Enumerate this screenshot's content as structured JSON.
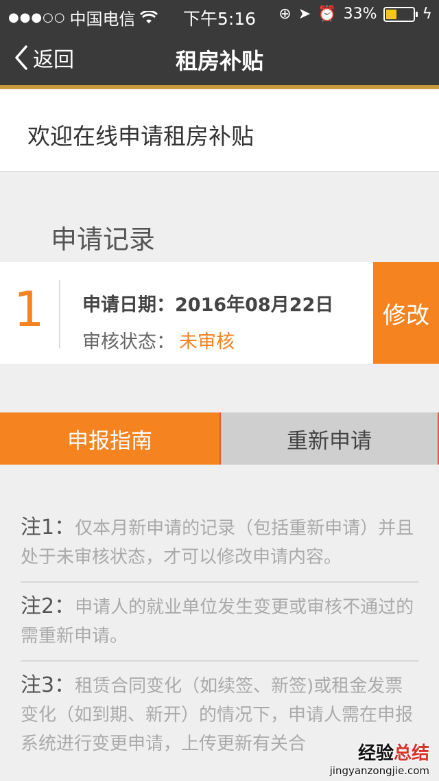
{
  "status": {
    "carrier": "中国电信",
    "time": "下午5:16",
    "battery": "33%"
  },
  "nav": {
    "back_label": "返回",
    "title": "租房补贴"
  },
  "welcome": "欢迎在线申请租房补贴",
  "section_title": "申请记录",
  "record": {
    "index": "1",
    "date_label": "申请日期：",
    "date_value": "2016年08月22日",
    "status_label": "审核状态：",
    "status_value": "未审核",
    "edit_label": "修改"
  },
  "tabs": {
    "guide": "申报指南",
    "reapply": "重新申请"
  },
  "notes": [
    {
      "label": "注1：",
      "text": "仅本月新申请的记录（包括重新申请）并且处于未审核状态，才可以修改申请内容。"
    },
    {
      "label": "注2：",
      "text": "申请人的就业单位发生变更或审核不通过的需重新申请。"
    },
    {
      "label": "注3：",
      "text": "租赁合同变化（如续签、新签)或租金发票变化（如到期、新开）的情况下，申请人需在申报系统进行变更申请，上传更新有关合"
    }
  ],
  "watermark": {
    "brand_part1": "经验",
    "brand_part2": "总结",
    "url": "jingyanzongjie.com"
  },
  "colors": {
    "accent": "#f48320",
    "topbar": "#3a3a3a",
    "accent_line": "#c99a3c"
  }
}
